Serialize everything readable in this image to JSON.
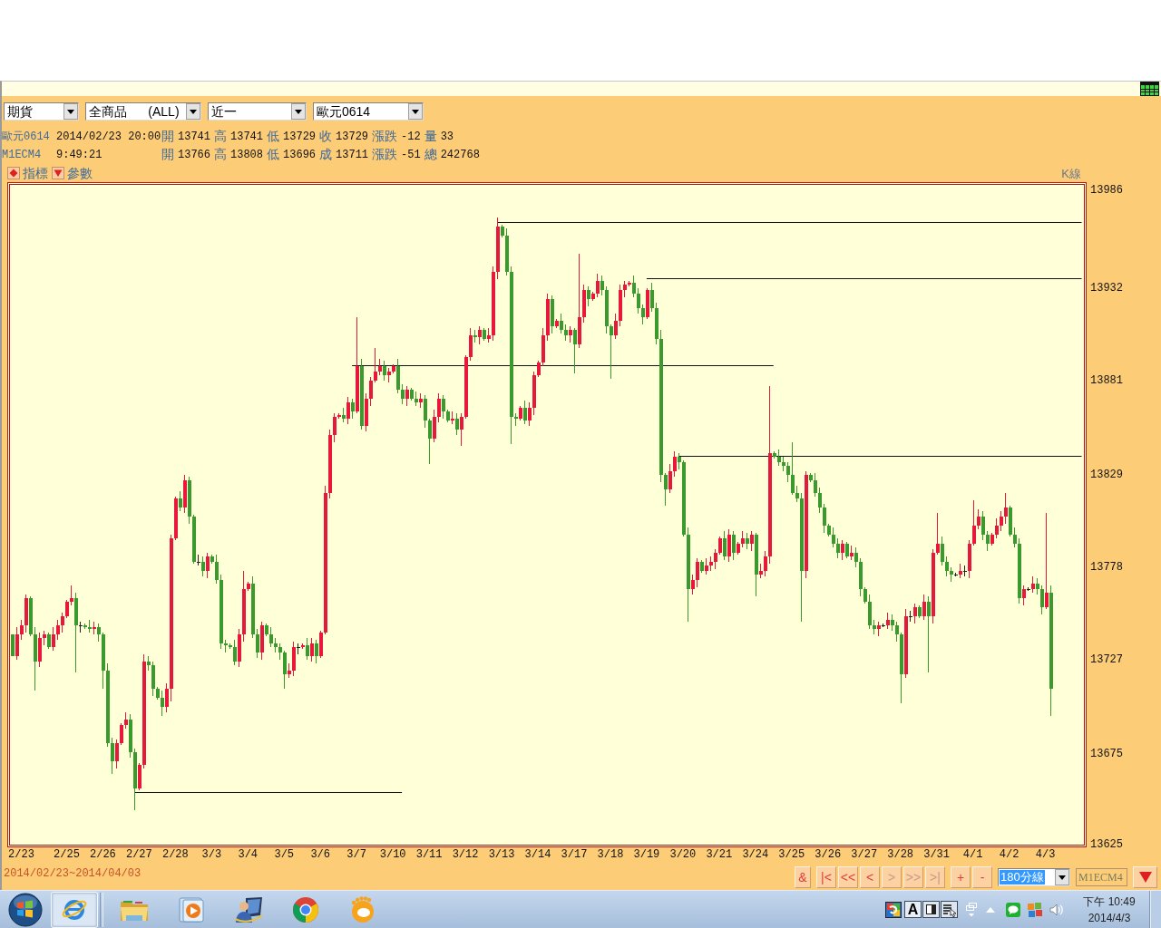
{
  "toolbar": {
    "dropdowns": [
      {
        "value": "期貨"
      },
      {
        "value": "全商品      (ALL)"
      },
      {
        "value": "近一"
      },
      {
        "value": "歐元0614"
      }
    ]
  },
  "quote_lines": [
    {
      "symbol": "歐元0614",
      "time": "2014/02/23 20:00",
      "fields": [
        {
          "label": "開",
          "value": "13741"
        },
        {
          "label": "高",
          "value": "13741"
        },
        {
          "label": "低",
          "value": "13729"
        },
        {
          "label": "收",
          "value": "13729"
        },
        {
          "label": "漲跌",
          "value": "-12"
        },
        {
          "label": "量",
          "value": "33"
        }
      ]
    },
    {
      "symbol": "M1ECM4",
      "time": "9:49:21",
      "fields": [
        {
          "label": "開",
          "value": "13766"
        },
        {
          "label": "高",
          "value": "13808"
        },
        {
          "label": "低",
          "value": "13696"
        },
        {
          "label": "成",
          "value": "13711"
        },
        {
          "label": "漲跌",
          "value": "-51"
        },
        {
          "label": "總",
          "value": "242768"
        }
      ]
    }
  ],
  "chart_header": {
    "buttons": [
      {
        "label": "指標"
      },
      {
        "label": "參數"
      }
    ],
    "chart_type": "K線"
  },
  "chart": {
    "chart_data": {
      "type": "candlestick",
      "categories": [
        null,
        null,
        "2/23",
        null,
        null,
        null,
        null,
        null,
        null,
        null,
        null,
        null,
        "2/25",
        null,
        null,
        null,
        null,
        null,
        null,
        null,
        "2/26",
        null,
        null,
        null,
        null,
        null,
        null,
        null,
        "2/27",
        null,
        null,
        null,
        null,
        null,
        null,
        null,
        "2/28",
        null,
        null,
        null,
        null,
        null,
        null,
        null,
        "3/3",
        null,
        null,
        null,
        null,
        null,
        null,
        null,
        "3/4",
        null,
        null,
        null,
        null,
        null,
        null,
        null,
        "3/5",
        null,
        null,
        null,
        null,
        null,
        null,
        null,
        "3/6",
        null,
        null,
        null,
        null,
        null,
        null,
        null,
        "3/7",
        null,
        null,
        null,
        null,
        null,
        null,
        null,
        "3/10",
        null,
        null,
        null,
        null,
        null,
        null,
        null,
        "3/11",
        null,
        null,
        null,
        null,
        null,
        null,
        null,
        "3/12",
        null,
        null,
        null,
        null,
        null,
        null,
        null,
        "3/13",
        null,
        null,
        null,
        null,
        null,
        null,
        null,
        "3/14",
        null,
        null,
        null,
        null,
        null,
        null,
        null,
        "3/17",
        null,
        null,
        null,
        null,
        null,
        null,
        null,
        "3/18",
        null,
        null,
        null,
        null,
        null,
        null,
        null,
        "3/19",
        null,
        null,
        null,
        null,
        null,
        null,
        null,
        "3/20",
        null,
        null,
        null,
        null,
        null,
        null,
        null,
        "3/21",
        null,
        null,
        null,
        null,
        null,
        null,
        null,
        "3/24",
        null,
        null,
        null,
        null,
        null,
        null,
        null,
        "3/25",
        null,
        null,
        null,
        null,
        null,
        null,
        null,
        "3/26",
        null,
        null,
        null,
        null,
        null,
        null,
        null,
        "3/27",
        null,
        null,
        null,
        null,
        null,
        null,
        null,
        "3/28",
        null,
        null,
        null,
        null,
        null,
        null,
        null,
        "3/31",
        null,
        null,
        null,
        null,
        null,
        null,
        null,
        "4/1",
        null,
        null,
        null,
        null,
        null,
        null,
        null,
        "4/2",
        null,
        null,
        null,
        null,
        null,
        null,
        null,
        "4/3",
        null,
        null,
        null,
        null,
        null,
        null,
        null,
        null
      ],
      "ohlc": [
        [
          13741,
          13741,
          13729,
          13729
        ],
        [
          13729,
          13745,
          13727,
          13741
        ],
        [
          13741,
          13749,
          13738,
          13746
        ],
        [
          13746,
          13763,
          13742,
          13761
        ],
        [
          13761,
          13762,
          13740,
          13741
        ],
        [
          13741,
          13745,
          13710,
          13726
        ],
        [
          13726,
          13742,
          13723,
          13739
        ],
        [
          13739,
          13743,
          13735,
          13741
        ],
        [
          13741,
          13742,
          13733,
          13734
        ],
        [
          13734,
          13745,
          13732,
          13741
        ],
        [
          13741,
          13749,
          13738,
          13746
        ],
        [
          13746,
          13753,
          13742,
          13751
        ],
        [
          13751,
          13760,
          13750,
          13759
        ],
        [
          13759,
          13768,
          13757,
          13761
        ],
        [
          13761,
          13764,
          13720,
          13746
        ],
        [
          13746,
          13748,
          13742,
          13746
        ],
        [
          13746,
          13747,
          13744,
          13745
        ],
        [
          13745,
          13749,
          13742,
          13744
        ],
        [
          13744,
          13748,
          13741,
          13745
        ],
        [
          13745,
          13747,
          13737,
          13741
        ],
        [
          13741,
          13742,
          13711,
          13721
        ],
        [
          13721,
          13725,
          13679,
          13681
        ],
        [
          13681,
          13684,
          13664,
          13671
        ],
        [
          13671,
          13683,
          13667,
          13681
        ],
        [
          13681,
          13692,
          13680,
          13691
        ],
        [
          13691,
          13698,
          13689,
          13694
        ],
        [
          13694,
          13697,
          13673,
          13676
        ],
        [
          13676,
          13678,
          13644,
          13656
        ],
        [
          13656,
          13670,
          13655,
          13669
        ],
        [
          13669,
          13730,
          13667,
          13726
        ],
        [
          13726,
          13729,
          13721,
          13724
        ],
        [
          13724,
          13726,
          13707,
          13711
        ],
        [
          13711,
          13712,
          13705,
          13706
        ],
        [
          13706,
          13710,
          13696,
          13701
        ],
        [
          13701,
          13714,
          13698,
          13711
        ],
        [
          13711,
          13796,
          13704,
          13794
        ],
        [
          13794,
          13817,
          13793,
          13816
        ],
        [
          13816,
          13820,
          13809,
          13811
        ],
        [
          13811,
          13829,
          13808,
          13826
        ],
        [
          13826,
          13828,
          13802,
          13806
        ],
        [
          13806,
          13807,
          13780,
          13781
        ],
        [
          13781,
          13785,
          13779,
          13781
        ],
        [
          13781,
          13784,
          13773,
          13776
        ],
        [
          13776,
          13786,
          13772,
          13784
        ],
        [
          13784,
          13785,
          13780,
          13781
        ],
        [
          13781,
          13785,
          13769,
          13771
        ],
        [
          13771,
          13774,
          13733,
          13736
        ],
        [
          13736,
          13738,
          13731,
          13735
        ],
        [
          13735,
          13736,
          13733,
          13734
        ],
        [
          13734,
          13738,
          13724,
          13726
        ],
        [
          13726,
          13744,
          13723,
          13741
        ],
        [
          13741,
          13776,
          13737,
          13766
        ],
        [
          13766,
          13770,
          13765,
          13769
        ],
        [
          13769,
          13773,
          13739,
          13741
        ],
        [
          13741,
          13744,
          13728,
          13731
        ],
        [
          13731,
          13748,
          13727,
          13746
        ],
        [
          13746,
          13747,
          13740,
          13741
        ],
        [
          13741,
          13745,
          13734,
          13736
        ],
        [
          13736,
          13739,
          13731,
          13734
        ],
        [
          13734,
          13736,
          13727,
          13731
        ],
        [
          13731,
          13732,
          13711,
          13719
        ],
        [
          13719,
          13725,
          13717,
          13721
        ],
        [
          13721,
          13737,
          13718,
          13734
        ],
        [
          13734,
          13736,
          13730,
          13734
        ],
        [
          13734,
          13736,
          13733,
          13735
        ],
        [
          13735,
          13739,
          13727,
          13729
        ],
        [
          13729,
          13739,
          13726,
          13736
        ],
        [
          13736,
          13738,
          13725,
          13729
        ],
        [
          13729,
          13743,
          13728,
          13742
        ],
        [
          13742,
          13823,
          13741,
          13819
        ],
        [
          13819,
          13854,
          13816,
          13851
        ],
        [
          13851,
          13863,
          13847,
          13861
        ],
        [
          13861,
          13863,
          13860,
          13862
        ],
        [
          13862,
          13866,
          13858,
          13860
        ],
        [
          13860,
          13872,
          13857,
          13869
        ],
        [
          13869,
          13871,
          13860,
          13864
        ],
        [
          13864,
          13916,
          13863,
          13889
        ],
        [
          13889,
          13893,
          13854,
          13856
        ],
        [
          13856,
          13874,
          13853,
          13871
        ],
        [
          13871,
          13883,
          13867,
          13881
        ],
        [
          13881,
          13899,
          13880,
          13886
        ],
        [
          13886,
          13893,
          13884,
          13889
        ],
        [
          13889,
          13892,
          13881,
          13884
        ],
        [
          13884,
          13888,
          13880,
          13886
        ],
        [
          13886,
          13890,
          13885,
          13889
        ],
        [
          13889,
          13893,
          13874,
          13876
        ],
        [
          13876,
          13879,
          13868,
          13871
        ],
        [
          13871,
          13878,
          13867,
          13876
        ],
        [
          13876,
          13877,
          13870,
          13871
        ],
        [
          13871,
          13875,
          13867,
          13869
        ],
        [
          13869,
          13874,
          13866,
          13871
        ],
        [
          13871,
          13873,
          13855,
          13859
        ],
        [
          13859,
          13860,
          13835,
          13849
        ],
        [
          13849,
          13865,
          13847,
          13861
        ],
        [
          13861,
          13874,
          13858,
          13871
        ],
        [
          13871,
          13873,
          13860,
          13864
        ],
        [
          13864,
          13865,
          13858,
          13859
        ],
        [
          13859,
          13864,
          13857,
          13860
        ],
        [
          13860,
          13863,
          13851,
          13854
        ],
        [
          13854,
          13863,
          13845,
          13861
        ],
        [
          13861,
          13895,
          13860,
          13894
        ],
        [
          13894,
          13910,
          13892,
          13906
        ],
        [
          13906,
          13909,
          13902,
          13905
        ],
        [
          13905,
          13911,
          13901,
          13909
        ],
        [
          13909,
          13910,
          13903,
          13904
        ],
        [
          13904,
          13910,
          13902,
          13906
        ],
        [
          13906,
          13944,
          13903,
          13941
        ],
        [
          13941,
          13971,
          13937,
          13966
        ],
        [
          13966,
          13967,
          13960,
          13961
        ],
        [
          13961,
          13965,
          13939,
          13941
        ],
        [
          13941,
          13944,
          13846,
          13861
        ],
        [
          13861,
          13863,
          13856,
          13860
        ],
        [
          13860,
          13867,
          13859,
          13866
        ],
        [
          13866,
          13870,
          13857,
          13859
        ],
        [
          13859,
          13869,
          13856,
          13866
        ],
        [
          13866,
          13886,
          13862,
          13884
        ],
        [
          13884,
          13892,
          13883,
          13891
        ],
        [
          13891,
          13910,
          13889,
          13906
        ],
        [
          13906,
          13929,
          13903,
          13926
        ],
        [
          13926,
          13928,
          13907,
          13911
        ],
        [
          13911,
          13915,
          13910,
          13914
        ],
        [
          13914,
          13918,
          13907,
          13909
        ],
        [
          13909,
          13912,
          13903,
          13906
        ],
        [
          13906,
          13911,
          13902,
          13909
        ],
        [
          13909,
          13910,
          13885,
          13901
        ],
        [
          13901,
          13951,
          13899,
          13916
        ],
        [
          13916,
          13934,
          13913,
          13931
        ],
        [
          13931,
          13933,
          13922,
          13926
        ],
        [
          13926,
          13930,
          13925,
          13929
        ],
        [
          13929,
          13940,
          13927,
          13936
        ],
        [
          13936,
          13939,
          13928,
          13931
        ],
        [
          13931,
          13933,
          13907,
          13911
        ],
        [
          13911,
          13912,
          13882,
          13906
        ],
        [
          13906,
          13918,
          13904,
          13914
        ],
        [
          13914,
          13934,
          13911,
          13931
        ],
        [
          13931,
          13936,
          13927,
          13934
        ],
        [
          13934,
          13936,
          13933,
          13935
        ],
        [
          13935,
          13939,
          13927,
          13929
        ],
        [
          13929,
          13932,
          13918,
          13921
        ],
        [
          13921,
          13923,
          13912,
          13916
        ],
        [
          13916,
          13932,
          13915,
          13931
        ],
        [
          13931,
          13935,
          13919,
          13921
        ],
        [
          13921,
          13924,
          13901,
          13904
        ],
        [
          13904,
          13909,
          13825,
          13829
        ],
        [
          13829,
          13830,
          13812,
          13821
        ],
        [
          13821,
          13835,
          13819,
          13831
        ],
        [
          13831,
          13842,
          13828,
          13839
        ],
        [
          13839,
          13841,
          13832,
          13836
        ],
        [
          13836,
          13837,
          13795,
          13796
        ],
        [
          13796,
          13800,
          13748,
          13766
        ],
        [
          13766,
          13774,
          13763,
          13771
        ],
        [
          13771,
          13783,
          13767,
          13781
        ],
        [
          13781,
          13782,
          13775,
          13776
        ],
        [
          13776,
          13783,
          13774,
          13779
        ],
        [
          13779,
          13784,
          13776,
          13781
        ],
        [
          13781,
          13788,
          13777,
          13786
        ],
        [
          13786,
          13795,
          13785,
          13794
        ],
        [
          13794,
          13798,
          13782,
          13784
        ],
        [
          13784,
          13799,
          13781,
          13796
        ],
        [
          13796,
          13798,
          13782,
          13786
        ],
        [
          13786,
          13792,
          13785,
          13791
        ],
        [
          13791,
          13798,
          13789,
          13794
        ],
        [
          13794,
          13797,
          13788,
          13791
        ],
        [
          13791,
          13798,
          13787,
          13796
        ],
        [
          13796,
          13797,
          13762,
          13774
        ],
        [
          13774,
          13780,
          13772,
          13776
        ],
        [
          13776,
          13787,
          13773,
          13784
        ],
        [
          13784,
          13878,
          13780,
          13841
        ],
        [
          13841,
          13842,
          13838,
          13839
        ],
        [
          13839,
          13843,
          13834,
          13836
        ],
        [
          13836,
          13839,
          13831,
          13834
        ],
        [
          13834,
          13836,
          13825,
          13829
        ],
        [
          13829,
          13847,
          13818,
          13819
        ],
        [
          13819,
          13823,
          13814,
          13816
        ],
        [
          13816,
          13819,
          13748,
          13776
        ],
        [
          13776,
          13831,
          13772,
          13829
        ],
        [
          13829,
          13830,
          13825,
          13826
        ],
        [
          13826,
          13830,
          13817,
          13819
        ],
        [
          13819,
          13822,
          13808,
          13811
        ],
        [
          13811,
          13813,
          13797,
          13801
        ],
        [
          13801,
          13802,
          13795,
          13796
        ],
        [
          13796,
          13800,
          13789,
          13791
        ],
        [
          13791,
          13794,
          13783,
          13786
        ],
        [
          13786,
          13793,
          13782,
          13791
        ],
        [
          13791,
          13792,
          13783,
          13784
        ],
        [
          13784,
          13790,
          13782,
          13786
        ],
        [
          13786,
          13789,
          13778,
          13781
        ],
        [
          13781,
          13783,
          13762,
          13766
        ],
        [
          13766,
          13767,
          13758,
          13759
        ],
        [
          13759,
          13763,
          13744,
          13746
        ],
        [
          13746,
          13749,
          13741,
          13744
        ],
        [
          13744,
          13748,
          13740,
          13746
        ],
        [
          13746,
          13747,
          13745,
          13746
        ],
        [
          13746,
          13753,
          13744,
          13749
        ],
        [
          13749,
          13752,
          13743,
          13746
        ],
        [
          13746,
          13748,
          13737,
          13741
        ],
        [
          13741,
          13742,
          13703,
          13719
        ],
        [
          13719,
          13755,
          13717,
          13751
        ],
        [
          13751,
          13754,
          13748,
          13751
        ],
        [
          13751,
          13758,
          13747,
          13756
        ],
        [
          13756,
          13757,
          13750,
          13751
        ],
        [
          13751,
          13763,
          13749,
          13759
        ],
        [
          13759,
          13762,
          13720,
          13751
        ],
        [
          13751,
          13788,
          13747,
          13786
        ],
        [
          13786,
          13808,
          13785,
          13791
        ],
        [
          13791,
          13795,
          13779,
          13781
        ],
        [
          13781,
          13784,
          13773,
          13776
        ],
        [
          13776,
          13778,
          13770,
          13774
        ],
        [
          13774,
          13775,
          13773,
          13774
        ],
        [
          13774,
          13780,
          13772,
          13776
        ],
        [
          13776,
          13779,
          13773,
          13776
        ],
        [
          13776,
          13793,
          13772,
          13791
        ],
        [
          13791,
          13815,
          13790,
          13801
        ],
        [
          13801,
          13810,
          13799,
          13806
        ],
        [
          13806,
          13809,
          13793,
          13796
        ],
        [
          13796,
          13798,
          13787,
          13791
        ],
        [
          13791,
          13797,
          13790,
          13796
        ],
        [
          13796,
          13805,
          13794,
          13801
        ],
        [
          13801,
          13809,
          13798,
          13806
        ],
        [
          13806,
          13819,
          13802,
          13811
        ],
        [
          13811,
          13812,
          13795,
          13796
        ],
        [
          13796,
          13800,
          13789,
          13791
        ],
        [
          13791,
          13794,
          13758,
          13761
        ],
        [
          13761,
          13768,
          13757,
          13766
        ],
        [
          13766,
          13767,
          13765,
          13766
        ],
        [
          13766,
          13773,
          13764,
          13769
        ],
        [
          13769,
          13772,
          13763,
          13766
        ],
        [
          13766,
          13768,
          13752,
          13756
        ],
        [
          13756,
          13808,
          13755,
          13764
        ],
        [
          13764,
          13768,
          13696,
          13711
        ],
        null,
        null,
        null,
        null,
        null,
        null,
        null
      ],
      "ref_lines": [
        {
          "axis": "y",
          "value": 13968
        },
        {
          "axis": "y",
          "value": 13937
        },
        {
          "axis": "y",
          "value": 13889
        },
        {
          "axis": "y",
          "value": 13839
        },
        {
          "axis": "y",
          "value": 13654
        }
      ],
      "ylim": [
        13625,
        13989
      ],
      "yticks": [
        13986,
        13932,
        13881,
        13829,
        13778,
        13727,
        13675,
        13625
      ]
    }
  },
  "footer": {
    "date_range": "2014/02/23~2014/04/03",
    "nav_groups": [
      [
        {
          "label": "&",
          "disabled": false
        }
      ],
      [
        {
          "label": "|<",
          "disabled": false
        },
        {
          "label": "<<",
          "disabled": false
        },
        {
          "label": "<",
          "disabled": false
        },
        {
          "label": ">",
          "disabled": true
        },
        {
          "label": ">>",
          "disabled": true
        },
        {
          "label": ">|",
          "disabled": true
        }
      ],
      [
        {
          "label": "+",
          "disabled": false
        },
        {
          "label": "-",
          "disabled": false
        }
      ]
    ],
    "interval": {
      "value": "180分線",
      "highlighted": true
    },
    "symbol_field": {
      "value": "M1ECM4",
      "disabled": true
    }
  },
  "taskbar": {
    "apps": [
      {
        "selected": true
      },
      {
        "selected": false
      },
      {
        "selected": false
      },
      {
        "selected": false
      },
      {
        "selected": false
      },
      {
        "selected": false
      }
    ],
    "tray": {
      "input_mode": "A"
    },
    "clock": {
      "time": "下午 10:49",
      "date": "2014/4/3"
    }
  }
}
